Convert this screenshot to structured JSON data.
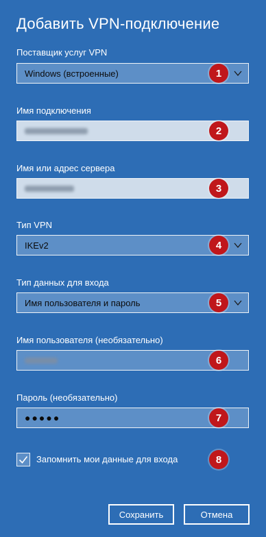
{
  "title": "Добавить VPN-подключение",
  "provider": {
    "label": "Поставщик услуг VPN",
    "value": "Windows (встроенные)"
  },
  "connection_name": {
    "label": "Имя подключения"
  },
  "server": {
    "label": "Имя или адрес сервера"
  },
  "vpn_type": {
    "label": "Тип VPN",
    "value": "IKEv2"
  },
  "signin_type": {
    "label": "Тип данных для входа",
    "value": "Имя пользователя и пароль"
  },
  "username": {
    "label": "Имя пользователя (необязательно)"
  },
  "password": {
    "label": "Пароль (необязательно)",
    "value": "●●●●●"
  },
  "remember": {
    "label": "Запомнить мои данные для входа",
    "checked": true
  },
  "buttons": {
    "save": "Сохранить",
    "cancel": "Отмена"
  },
  "badges": [
    "1",
    "2",
    "3",
    "4",
    "5",
    "6",
    "7",
    "8"
  ],
  "colors": {
    "background": "#2d6db5",
    "badge": "#c0171b"
  }
}
